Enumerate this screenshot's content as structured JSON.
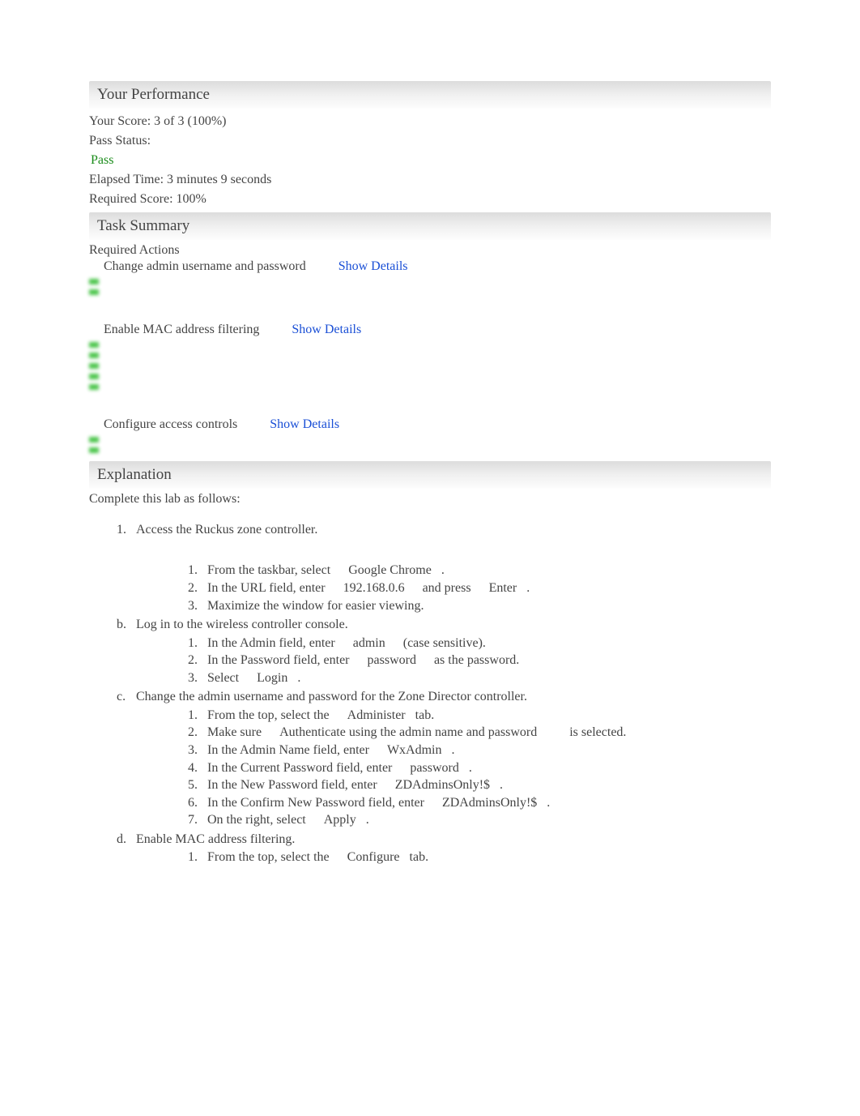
{
  "performance": {
    "header": "Your Performance",
    "score_label": "Your Score: 3 of 3 (100%)",
    "pass_status_label": "Pass Status:",
    "pass_value": "Pass",
    "elapsed_time": "Elapsed Time: 3 minutes 9 seconds",
    "required_score": "Required Score: 100%"
  },
  "task_summary": {
    "header": "Task Summary",
    "required_actions_label": "Required Actions",
    "actions": [
      {
        "label": "Change admin username and password",
        "details_label": "Show Details",
        "marker_count": 2
      },
      {
        "label": "Enable MAC address filtering",
        "details_label": "Show Details",
        "marker_count": 5
      },
      {
        "label": "Configure access controls",
        "details_label": "Show Details",
        "marker_count": 2
      }
    ]
  },
  "explanation": {
    "header": "Explanation",
    "intro": "Complete this lab as follows:",
    "steps": [
      {
        "num": "1.",
        "text": "Access the Ruckus zone controller.",
        "sub": [
          {
            "num": "1.",
            "parts": [
              "From the taskbar, select",
              "Google Chrome",
              "."
            ]
          },
          {
            "num": "2.",
            "parts": [
              "In the URL field, enter",
              "192.168.0.6",
              "and press",
              "Enter",
              "."
            ]
          },
          {
            "num": "3.",
            "parts": [
              "Maximize the window for easier viewing."
            ]
          }
        ]
      },
      {
        "num": "b.",
        "text": "Log in to the wireless controller console.",
        "sub": [
          {
            "num": "1.",
            "parts": [
              "In the Admin field, enter",
              "admin",
              "(case sensitive)."
            ]
          },
          {
            "num": "2.",
            "parts": [
              "In the Password field, enter",
              "password",
              "as the password."
            ]
          },
          {
            "num": "3.",
            "parts": [
              "Select",
              "Login",
              "."
            ]
          }
        ]
      },
      {
        "num": "c.",
        "text": "Change the admin username and password for the Zone Director controller.",
        "sub": [
          {
            "num": "1.",
            "parts": [
              "From the top, select the",
              "Administer",
              "tab."
            ]
          },
          {
            "num": "2.",
            "parts": [
              "Make sure",
              "Authenticate using the admin name and password",
              "is selected."
            ]
          },
          {
            "num": "3.",
            "parts": [
              "In the Admin Name field, enter",
              "WxAdmin",
              "."
            ]
          },
          {
            "num": "4.",
            "parts": [
              "In the Current Password field, enter",
              "password",
              "."
            ]
          },
          {
            "num": "5.",
            "parts": [
              "In the New Password field, enter",
              "ZDAdminsOnly!$",
              "."
            ]
          },
          {
            "num": "6.",
            "parts": [
              "In the Confirm New Password field, enter",
              "ZDAdminsOnly!$",
              "."
            ]
          },
          {
            "num": "7.",
            "parts": [
              "On the right, select",
              "Apply",
              "."
            ]
          }
        ]
      },
      {
        "num": "d.",
        "text": "Enable MAC address filtering.",
        "sub": [
          {
            "num": "1.",
            "parts": [
              "From the top, select the",
              "Configure",
              "tab."
            ]
          }
        ]
      }
    ]
  }
}
